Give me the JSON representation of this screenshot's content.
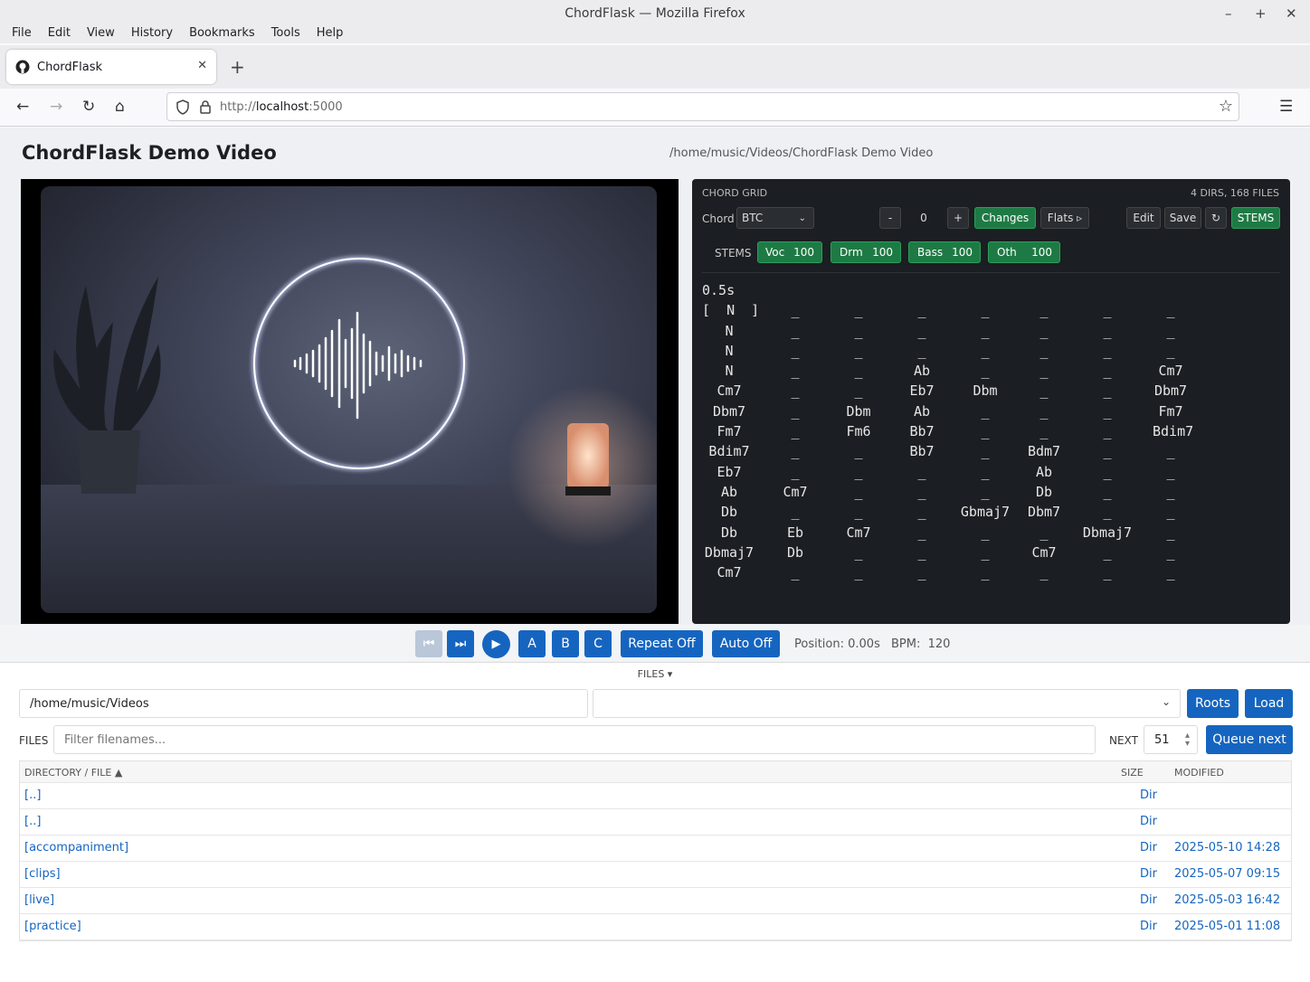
{
  "window": {
    "title": "ChordFlask — Mozilla Firefox"
  },
  "menu": [
    "File",
    "Edit",
    "View",
    "History",
    "Bookmarks",
    "Tools",
    "Help"
  ],
  "tab": {
    "label": "ChordFlask"
  },
  "url": {
    "scheme": "http://",
    "host": "localhost",
    "port": ":5000"
  },
  "page": {
    "title": "ChordFlask Demo Video",
    "path": "/home/music/Videos/ChordFlask Demo Video"
  },
  "grid": {
    "header": "CHORD GRID",
    "count": "4 DIRS, 168 FILES",
    "chord_label": "Chord",
    "chord_select": "BTC",
    "minus": "-",
    "transpose": "0",
    "plus": "+",
    "changes": "Changes",
    "flats": "Flats ▹",
    "edit": "Edit",
    "save": "Save",
    "refresh_icon": "↻",
    "stems_btn": "STEMS",
    "stems_label": "STEMS",
    "stems": [
      {
        "name": "Voc",
        "value": "100"
      },
      {
        "name": "Drm",
        "value": "100"
      },
      {
        "name": "Bass",
        "value": "100"
      },
      {
        "name": "Oth",
        "value": "100"
      }
    ],
    "interval": "0.5s",
    "rows": [
      [
        "[  N  ]",
        "_",
        "_",
        "_",
        "_",
        "_",
        "_",
        "_"
      ],
      [
        "N",
        "_",
        "_",
        "_",
        "_",
        "_",
        "_",
        "_"
      ],
      [
        "N",
        "_",
        "_",
        "_",
        "_",
        "_",
        "_",
        "_"
      ],
      [
        "N",
        "_",
        "_",
        "Ab",
        "_",
        "_",
        "_",
        "Cm7"
      ],
      [
        "Cm7",
        "_",
        "_",
        "Eb7",
        "Dbm",
        "_",
        "_",
        "Dbm7"
      ],
      [
        "Dbm7",
        "_",
        "Dbm",
        "Ab",
        "_",
        "_",
        "_",
        "Fm7"
      ],
      [
        "Fm7",
        "_",
        "Fm6",
        "Bb7",
        "_",
        "_",
        "_",
        "Bdim7"
      ],
      [
        "Bdim7",
        "_",
        "_",
        "Bb7",
        "_",
        "Bdm7",
        "_",
        "_"
      ],
      [
        "Eb7",
        "_",
        "_",
        "_",
        "_",
        "Ab",
        "_",
        "_"
      ],
      [
        "Ab",
        "Cm7",
        "_",
        "_",
        "_",
        "Db",
        "_",
        "_"
      ],
      [
        "Db",
        "_",
        "_",
        "_",
        "Gbmaj7",
        "Dbm7",
        "_",
        "_"
      ],
      [
        "Db",
        "Eb",
        "Cm7",
        "_",
        "_",
        "_",
        "Dbmaj7",
        "_"
      ],
      [
        "Dbmaj7",
        "Db",
        "_",
        "_",
        "_",
        "Cm7",
        "_",
        "_"
      ],
      [
        "Cm7",
        "_",
        "_",
        "_",
        "_",
        "_",
        "_",
        "_"
      ]
    ]
  },
  "transport": {
    "prev_icon": "⏮",
    "next_icon": "⏭",
    "play_icon": "▶",
    "a": "A",
    "b": "B",
    "c": "C",
    "repeat": "Repeat Off",
    "auto": "Auto Off",
    "position": "Position: 0.00s",
    "bpm": "BPM:  120"
  },
  "files": {
    "title": "FILES ▾",
    "dir_input": "/home/music/Videos",
    "roots": "Roots",
    "load": "Load",
    "files_label": "FILES",
    "filter_placeholder": "Filter filenames...",
    "next_label": "NEXT",
    "next_value": "51",
    "queue_next": "Queue next",
    "columns": {
      "name": "DIRECTORY / FILE ▲",
      "size": "SIZE",
      "modified": "MODIFIED"
    },
    "rows": [
      {
        "name": "[..]",
        "size": "Dir",
        "modified": ""
      },
      {
        "name": "[..]",
        "size": "Dir",
        "modified": ""
      },
      {
        "name": "[accompaniment]",
        "size": "Dir",
        "modified": "2025-05-10 14:28"
      },
      {
        "name": "[clips]",
        "size": "Dir",
        "modified": "2025-05-07 09:15"
      },
      {
        "name": "[live]",
        "size": "Dir",
        "modified": "2025-05-03 16:42"
      },
      {
        "name": "[practice]",
        "size": "Dir",
        "modified": "2025-05-01 11:08"
      }
    ]
  }
}
